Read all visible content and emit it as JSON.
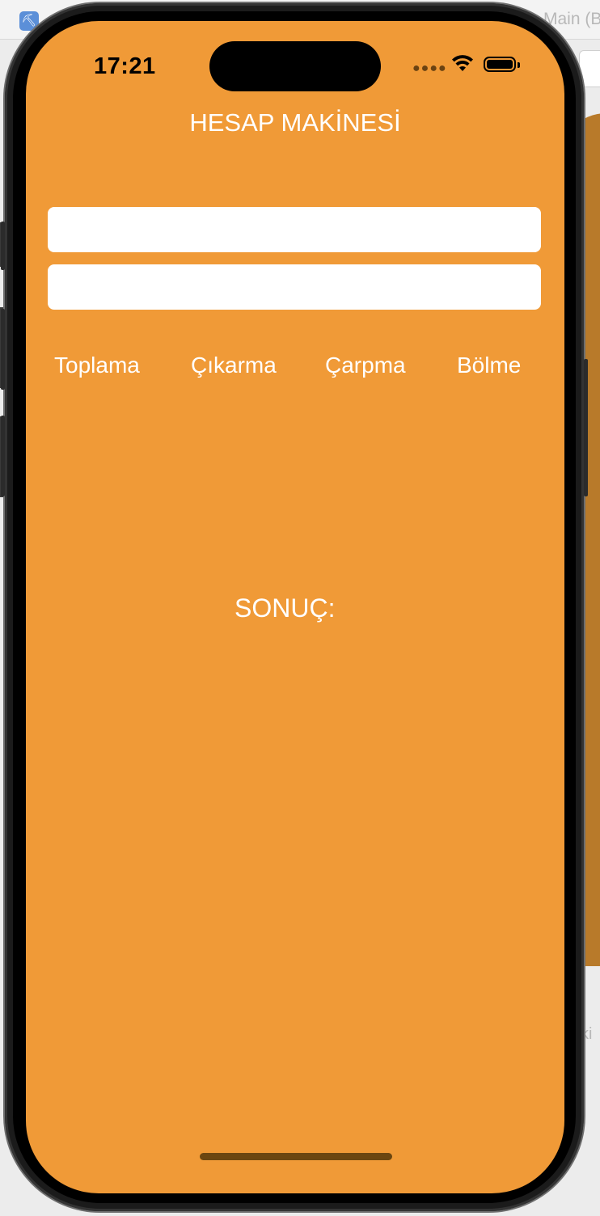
{
  "backdrop": {
    "tab_fragment": "Main (B",
    "bottom_fragment": "ki"
  },
  "status_bar": {
    "time": "17:21",
    "icons": [
      "cellular-dots-icon",
      "wifi-icon",
      "battery-icon"
    ]
  },
  "app": {
    "title": "HESAP MAKİNESİ",
    "first_number": {
      "value": "",
      "placeholder": ""
    },
    "second_number": {
      "value": "",
      "placeholder": ""
    },
    "operations": {
      "add": "Toplama",
      "subtract": "Çıkarma",
      "multiply": "Çarpma",
      "divide": "Bölme"
    },
    "result_label": "SONUÇ:"
  },
  "colors": {
    "screen_background": "#f09a37",
    "text": "#ffffff",
    "field_background": "#ffffff"
  }
}
